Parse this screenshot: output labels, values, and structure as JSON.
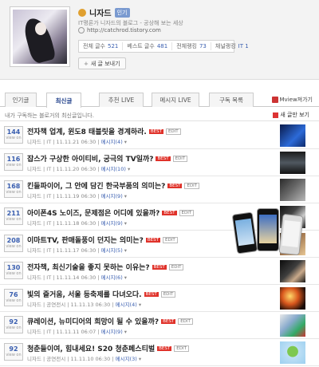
{
  "profile": {
    "nickname": "니자드",
    "badge": "인기",
    "intro": "IT평론가 니자드의 블로그 - 공상해 보는 세상",
    "homepage": "http://catchrod.tistory.com",
    "stats": [
      {
        "label": "전체 글수",
        "value": "521"
      },
      {
        "label": "베스트 글수",
        "value": "481"
      },
      {
        "label": "전체랭킹",
        "value": "73"
      },
      {
        "label": "채널랭킹",
        "value": "IT 1"
      }
    ],
    "write_button": "새 글 보내기"
  },
  "tabs": [
    {
      "label": "인기글"
    },
    {
      "label": "최신글"
    },
    {
      "label": "추천 LIVE"
    },
    {
      "label": "메시지 LIVE"
    },
    {
      "label": "구독 목록"
    }
  ],
  "mview_link": "Mview져가기",
  "subbar": {
    "description": "내가 구독하는 블로거의 최신글입니다.",
    "view_new": "새 글만 보기"
  },
  "posts": [
    {
      "count": "144",
      "unit": "view on",
      "title": "전자책 업계, 윈도8 태블릿을 경계하라.",
      "author": "니자드",
      "category": "IT",
      "date": "11.11.21 06:30",
      "messages": "메시지(4)"
    },
    {
      "count": "116",
      "unit": "view on",
      "title": "잡스가 구상한 아이티비, 궁극의 TV일까?",
      "author": "니자드",
      "category": "IT",
      "date": "11.11.20 06:30",
      "messages": "메시지(10)"
    },
    {
      "count": "168",
      "unit": "view on",
      "title": "킨들파이어, 그 안에 담긴 한국부품의 의미는?",
      "author": "니자드",
      "category": "IT",
      "date": "11.11.19 06:30",
      "messages": "메시지(9)"
    },
    {
      "count": "211",
      "unit": "view on",
      "title": "아이폰4S 노이즈, 문제점은 어디에 있을까?",
      "author": "니자드",
      "category": "IT",
      "date": "11.11.18 06:30",
      "messages": "메시지(9)"
    },
    {
      "count": "208",
      "unit": "view on",
      "title": "이마트TV, 판매돌풍이 던지는 의미는?",
      "author": "니자드",
      "category": "IT",
      "date": "11.11.17 06:30",
      "messages": "메시지(5)"
    },
    {
      "count": "130",
      "unit": "view on",
      "title": "전자책, 최신기술을 좋지 못하는 이유는?",
      "author": "니자드",
      "category": "IT",
      "date": "11.11.14 06:30",
      "messages": "메시지(6)"
    },
    {
      "count": "76",
      "unit": "view on",
      "title": "빛의 즐거움, 서울 등축제를 다녀오다.",
      "author": "니자드",
      "category": "공연전시",
      "date": "11.11.13 06:30",
      "messages": "메시지(4)"
    },
    {
      "count": "92",
      "unit": "view on",
      "title": "큐레이션, 뉴미디어의 희망이 될 수 있을까?",
      "author": "니자드",
      "category": "IT",
      "date": "11.11.11 06:07",
      "messages": "메시지(9)"
    },
    {
      "count": "92",
      "unit": "view on",
      "title": "청춘들이여, 힘내세요! S20 청춘페스티벌",
      "author": "니자드",
      "category": "공연전시",
      "date": "11.11.10 06:30",
      "messages": "메시지(3)"
    }
  ],
  "tags": {
    "best": "BEST",
    "edit": "EDIT"
  },
  "colors": {
    "accent": "#3a5fb0",
    "best_tag": "#e0322a",
    "header_bg": "#f3f3f3"
  },
  "icons": [
    "user-icon",
    "home-icon",
    "plus-icon",
    "mview-icon",
    "newpost-icon"
  ]
}
